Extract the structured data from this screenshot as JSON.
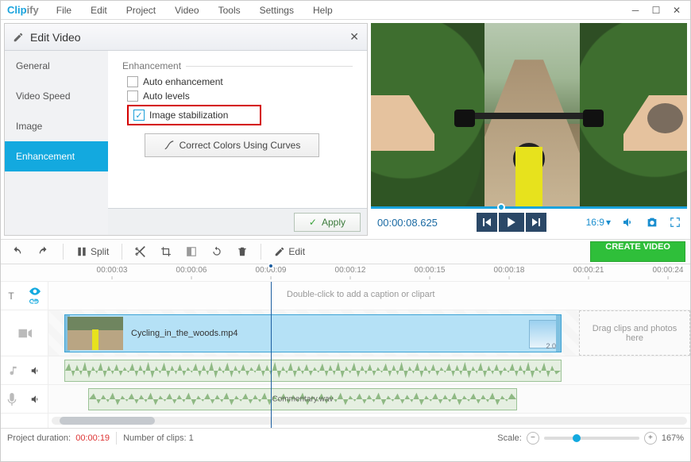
{
  "app": {
    "name1": "Clip",
    "name2": "ify"
  },
  "menu": [
    "File",
    "Edit",
    "Project",
    "Video",
    "Tools",
    "Settings",
    "Help"
  ],
  "panel": {
    "title": "Edit Video",
    "tabs": [
      "General",
      "Video Speed",
      "Image",
      "Enhancement"
    ],
    "active_tab_index": 3,
    "section": "Enhancement",
    "checks": {
      "auto_enh": {
        "label": "Auto enhancement",
        "checked": false
      },
      "auto_levels": {
        "label": "Auto levels",
        "checked": false
      },
      "img_stab": {
        "label": "Image stabilization",
        "checked": true
      }
    },
    "curves_btn": "Correct Colors Using Curves",
    "apply": "Apply"
  },
  "preview": {
    "timecode": "00:00:08.625",
    "aspect": "16:9"
  },
  "toolbar": {
    "split": "Split",
    "edit": "Edit",
    "create": "CREATE VIDEO"
  },
  "ruler": [
    "00:00:03",
    "00:00:06",
    "00:00:09",
    "00:00:12",
    "00:00:15",
    "00:00:18",
    "00:00:21",
    "00:00:24"
  ],
  "timeline": {
    "caption_hint": "Double-click to add a caption or clipart",
    "video_clip": "Cycling_in_the_woods.mp4",
    "end_label": "2.0",
    "drop_hint": "Drag clips and photos here",
    "voice_clip": "Commentary.wav"
  },
  "status": {
    "dur_label": "Project duration:",
    "dur_value": "00:00:19",
    "clips_label": "Number of clips:",
    "clips_value": "1",
    "scale_label": "Scale:",
    "scale_value": "167%"
  }
}
